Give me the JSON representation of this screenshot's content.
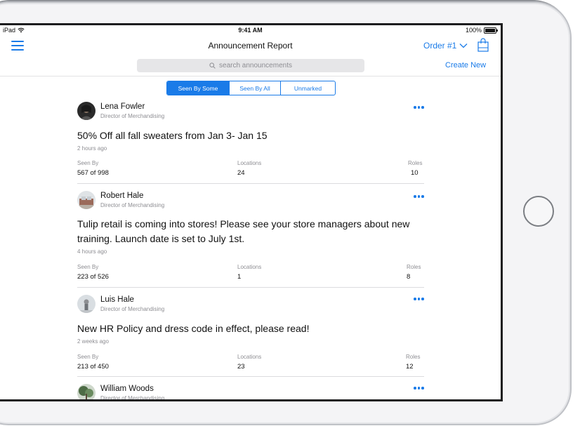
{
  "status_bar": {
    "device": "iPad",
    "time": "9:41 AM",
    "battery": "100%"
  },
  "header": {
    "title": "Announcement Report",
    "order_label": "Order #1",
    "create_new": "Create New"
  },
  "search": {
    "placeholder": "search announcements"
  },
  "tabs": [
    {
      "label": "Seen By Some",
      "active": true
    },
    {
      "label": "Seen By All",
      "active": false
    },
    {
      "label": "Unmarked",
      "active": false
    }
  ],
  "stat_labels": {
    "seen_by": "Seen By",
    "locations": "Locations",
    "roles": "Roles"
  },
  "announcements": [
    {
      "author": "Lena Fowler",
      "role": "Director of Merchandising",
      "headline": "50% Off all fall sweaters from Jan 3- Jan 15",
      "time": "2 hours ago",
      "seen_by": "567 of 998",
      "locations": "24",
      "roles": "10"
    },
    {
      "author": "Robert Hale",
      "role": "Director of Merchandising",
      "headline": "Tulip retail is coming into stores! Please see your store managers about new training. Launch date is set to July 1st.",
      "time": "4 hours ago",
      "seen_by": "223 of 526",
      "locations": "1",
      "roles": "8"
    },
    {
      "author": "Luis Hale",
      "role": "Director of Merchandising",
      "headline": "New HR Policy and dress code in effect, please read!",
      "time": "2 weeks ago",
      "seen_by": "213 of 450",
      "locations": "23",
      "roles": "12"
    },
    {
      "author": "William Woods",
      "role": "Director of Merchandising"
    }
  ],
  "colors": {
    "accent": "#1a7be8",
    "muted_text": "#8e8e93",
    "divider": "#dcdcdf"
  },
  "icons": [
    "wifi-icon",
    "battery-icon",
    "menu-icon",
    "chevron-down-icon",
    "shopping-bag-icon",
    "search-icon",
    "more-options-icon",
    "home-button"
  ]
}
